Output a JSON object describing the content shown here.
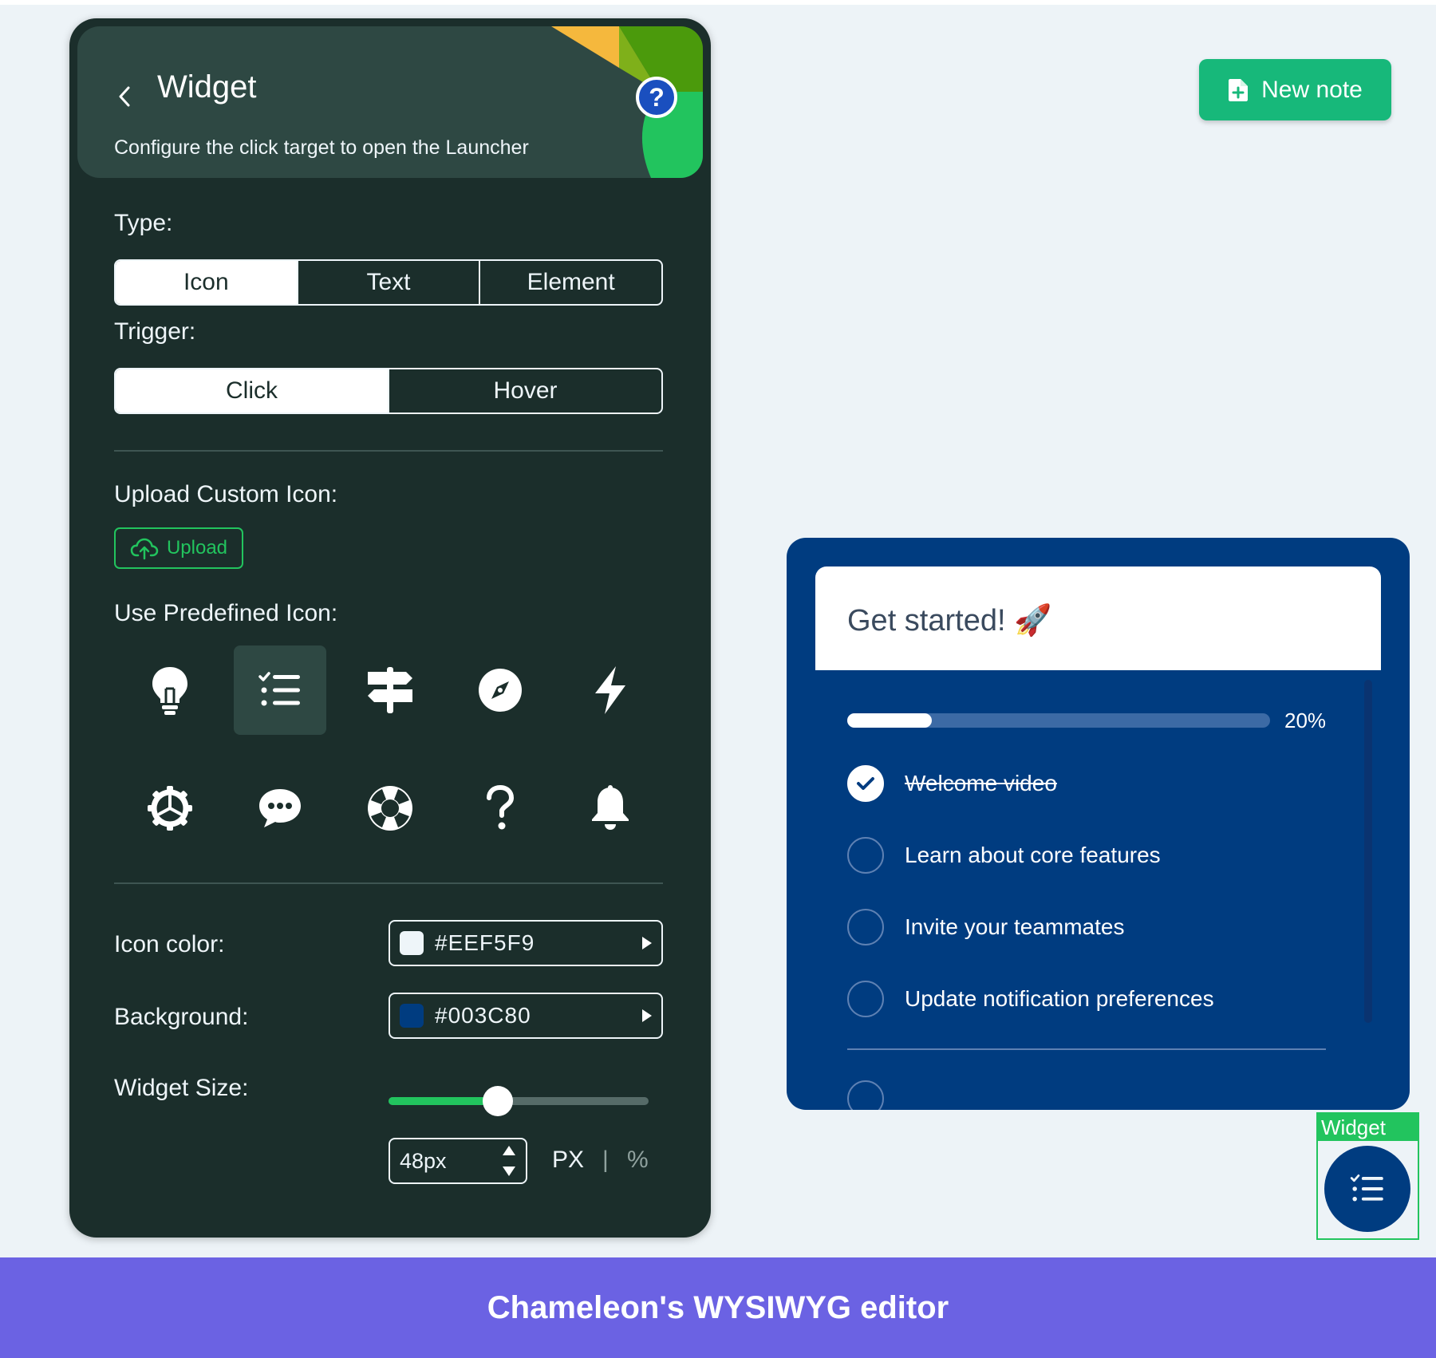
{
  "panel": {
    "title": "Widget",
    "subtitle": "Configure the click target to open the Launcher",
    "help": "?",
    "type_label": "Type:",
    "type_options": [
      "Icon",
      "Text",
      "Element"
    ],
    "type_selected": "Icon",
    "trigger_label": "Trigger:",
    "trigger_options": [
      "Click",
      "Hover"
    ],
    "trigger_selected": "Click",
    "upload_label": "Upload Custom Icon:",
    "upload_button": "Upload",
    "predefined_label": "Use Predefined Icon:",
    "icons": [
      "lightbulb-icon",
      "checklist-icon",
      "signpost-icon",
      "compass-icon",
      "lightning-icon",
      "gear-icon",
      "chat-bubble-icon",
      "lifebuoy-icon",
      "question-icon",
      "bell-icon"
    ],
    "selected_icon": "checklist-icon",
    "icon_color_label": "Icon color:",
    "icon_color": "#EEF5F9",
    "background_label": "Background:",
    "background_color": "#003C80",
    "size_label": "Widget Size:",
    "size_slider_fraction": 0.42,
    "size_value": "48px",
    "unit_px": "PX",
    "unit_separator": "|",
    "unit_percent": "%"
  },
  "preview": {
    "new_note": "New note",
    "checklist": {
      "title": "Get started! 🚀",
      "progress_percent": 20,
      "progress_label": "20%",
      "items": [
        {
          "label": "Welcome video",
          "done": true
        },
        {
          "label": "Learn about core features",
          "done": false
        },
        {
          "label": "Invite your teammates",
          "done": false
        },
        {
          "label": "Update notification preferences",
          "done": false
        }
      ]
    },
    "widget_tag": "Widget"
  },
  "footer": "Chameleon's WYSIWYG editor",
  "colors": {
    "panel_bg": "#1b2e2b",
    "accent_green": "#22c45e",
    "checklist_bg": "#003c80",
    "footer_bg": "#6b62e3",
    "new_note_bg": "#17b87a"
  }
}
